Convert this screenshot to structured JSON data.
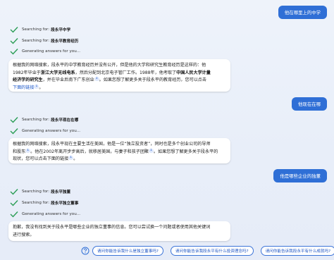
{
  "conversation": {
    "user1": "他在哪里上的中学",
    "status1": [
      {
        "prefix": "Searching for:",
        "query": "段永平中学"
      },
      {
        "prefix": "Searching for:",
        "query": "段永平教育经历"
      },
      {
        "prefix": "Generating answers for you...",
        "query": ""
      }
    ],
    "answer1": {
      "l1": "根据我的网络搜索，段永平的中学教育经历并没有公开，但是他的大学和研究生教育经历是这样的：他",
      "l2a": "1982年毕业于",
      "l2b": "浙江大学无线电系",
      "l2c": "，然后分配到北京电子管厂工作。1988年，他考取了",
      "l2d": "中国人民大学计量",
      "l3a": "经济学的研究生",
      "l3b": "，并在毕业后南下广东创业",
      "l3sup": "1",
      "l3c": "。如果您想了解更多关于段永平的教育经历，您可以点击",
      "l4a": "下面的链接",
      "l4sup": "1",
      "l4b": "。"
    },
    "user2": "他现在在哪",
    "status2": [
      {
        "prefix": "Searching for:",
        "query": "段永平现在在哪"
      },
      {
        "prefix": "Generating answers for you...",
        "query": ""
      }
    ],
    "answer2": {
      "l1": "根据我的网络搜索，段永平现在主要生活在美国，他是一位“独立投资者”，同时也是多个创业公司的导师",
      "l2a": "和股东",
      "l2sup1": "1",
      "l2b": "。他在2002年离开步步高后，就移居美国，与妻子和孩子团聚",
      "l2sup2": "1",
      "l2c": "。如果您想了解更多关于段永平的",
      "l3a": "现状，您可以点击下面的链接",
      "l3sup": "1",
      "l3b": "。"
    },
    "user3": "他是哪些企业的独董",
    "status3": [
      {
        "prefix": "Searching for:",
        "query": "段永平独董"
      },
      {
        "prefix": "Searching for:",
        "query": "段永平独立董事"
      },
      {
        "prefix": "Generating answers for you...",
        "query": ""
      }
    ],
    "answer3": {
      "l1": "抱歉，我没有找到关于段永平是哪些企业的独立董事的信息。您可以尝试换一个问题或者使用其他关键词",
      "l2": "进行搜索。"
    }
  },
  "suggestions": [
    "请问你能告诉我什么是独立董事吗?",
    "请问你能告诉我段永平有什么投资理念吗?",
    "请问你能告诉我段永平有什么成就吗?"
  ],
  "colors": {
    "accent": "#2f6fd6",
    "check": "#2a9d55"
  },
  "icons": {
    "status": "check-icon",
    "suggest": "question-circle-icon"
  }
}
